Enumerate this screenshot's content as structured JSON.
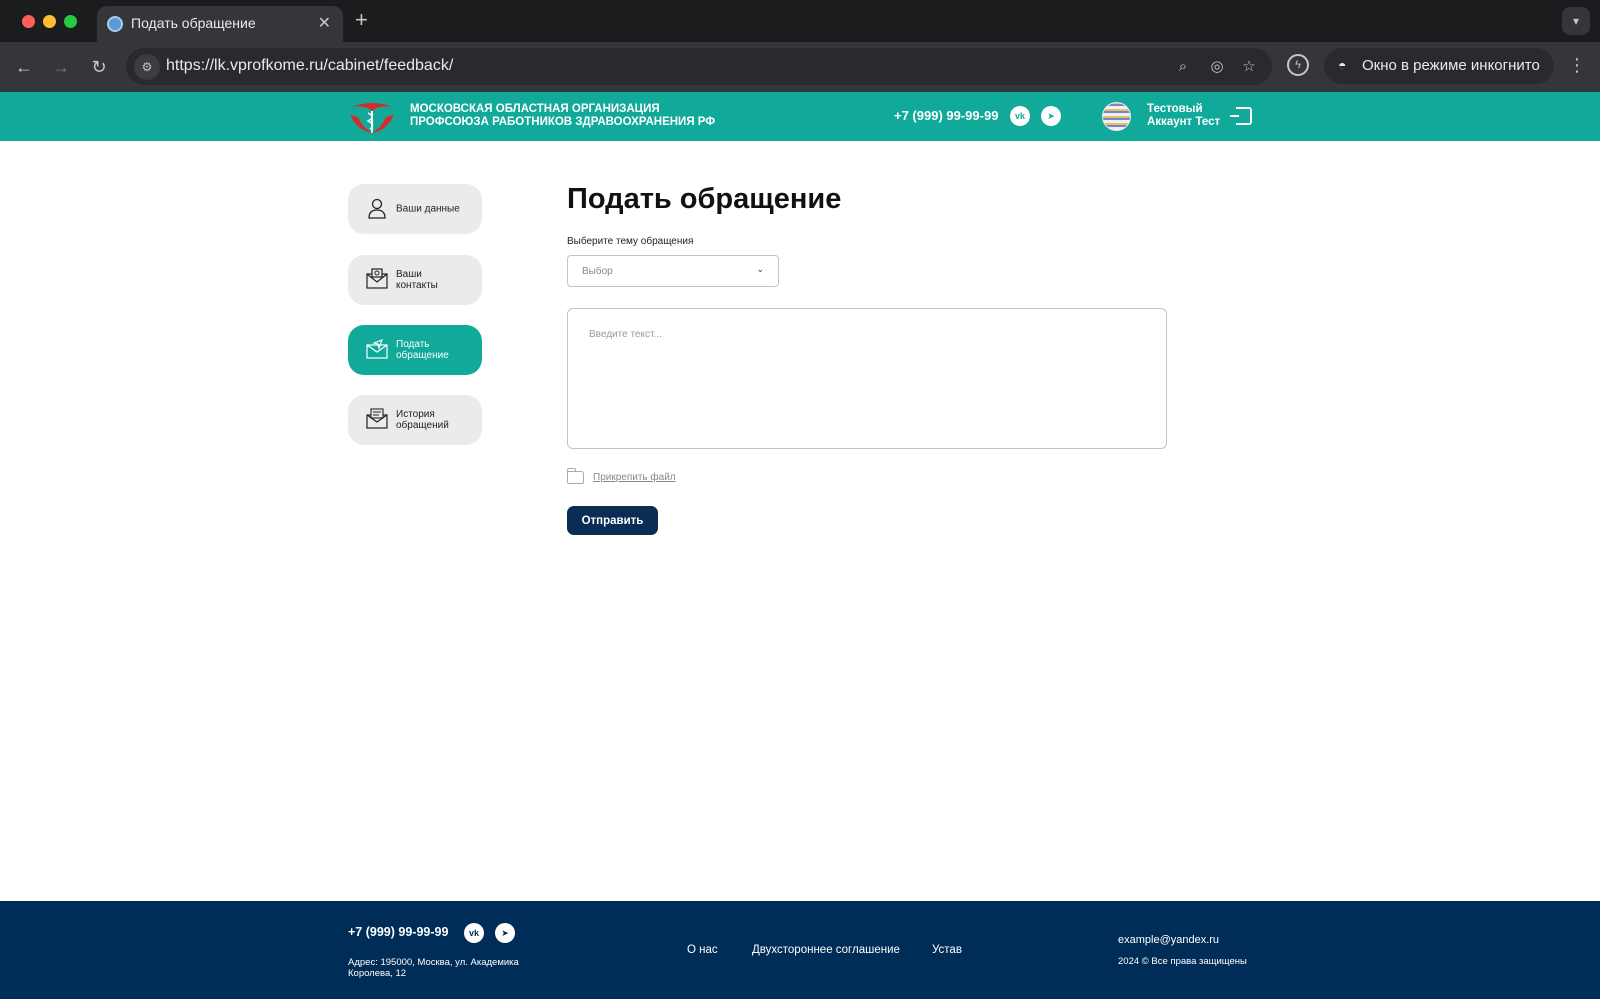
{
  "browser": {
    "tab_title": "Подать обращение",
    "tab_close": "✕",
    "new_tab": "+",
    "url": "https://lk.vprofkome.ru/cabinet/feedback/",
    "incognito_label": "Окно в режиме инкогнито"
  },
  "header": {
    "org_line1": "Московская областная организация",
    "org_line2": "профсоюза работников здравоохранения РФ",
    "phone": "+7 (999) 99-99-99",
    "vk_label": "vk",
    "tg_label": "➤",
    "account_line1": "Тестовый",
    "account_line2": "Аккаунт Тест",
    "brand_color": "#11a99a"
  },
  "sidebar": {
    "items": [
      {
        "line1": "Ваши данные",
        "line2": "",
        "icon": "user-icon",
        "active": false
      },
      {
        "line1": "Ваши",
        "line2": "контакты",
        "icon": "contacts-mail-icon",
        "active": false
      },
      {
        "line1": "Подать",
        "line2": "обращение",
        "icon": "send-mail-icon",
        "active": true
      },
      {
        "line1": "История",
        "line2": "обращений",
        "icon": "history-mail-icon",
        "active": false
      }
    ]
  },
  "main": {
    "title": "Подать обращение",
    "topic_label": "Выберите тему обращения",
    "topic_value": "Выбор",
    "message_placeholder": "Введите текст...",
    "attach_label": "Прикрепить файл",
    "submit_label": "Отправить",
    "submit_color": "#0b2d54"
  },
  "footer": {
    "phone": "+7 (999) 99-99-99",
    "address": "Адрес: 195000, Москва, ул. Академика Королева, 12",
    "links": [
      "О нас",
      "Двухстороннее соглашение",
      "Устав"
    ],
    "email": "example@yandex.ru",
    "copyright": "2024 © Все права защищены",
    "bg_color": "#002d57"
  }
}
